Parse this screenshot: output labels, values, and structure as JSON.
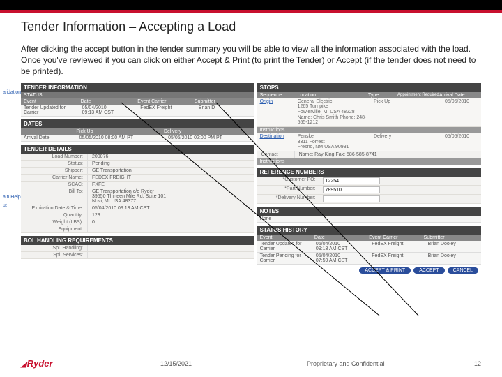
{
  "slide": {
    "title": "Tender Information – Accepting a Load",
    "body": "After clicking the accept button in the tender summary you will be able to view all the information associated with the load. Once you've reviewed it you can click on either Accept & Print (to print the Tender) or Accept (if the tender does not need to be printed)."
  },
  "left": {
    "tender_info": "TENDER INFORMATION",
    "status": "STATUS",
    "status_cols": {
      "event": "Event",
      "date": "Date",
      "carrier": "Event Carrier",
      "submitter": "Submitter"
    },
    "status_row": {
      "event": "Tender Updated for Carrier",
      "date1": "05/04/2010",
      "date2": "09:13 AM CST",
      "carrier": "FedEX Freight",
      "submitter": "Brian D"
    },
    "dates": "DATES",
    "dates_cols": {
      "blank": "",
      "pickup": "Pick Up",
      "delivery": "Delivery"
    },
    "dates_row": {
      "label": "Arrival Date",
      "pickup": "05/05/2010 08:00 AM PT",
      "delivery": "05/05/2010 02:00 PM PT"
    },
    "details": "TENDER DETAILS",
    "d": {
      "load_no_k": "Load Number:",
      "load_no_v": "200076",
      "status_k": "Status:",
      "status_v": "Pending",
      "shipper_k": "Shipper:",
      "shipper_v": "GE Transportation",
      "carrier_k": "Carrier Name:",
      "carrier_v": "FEDEX FREIGHT",
      "scac_k": "SCAC:",
      "scac_v": "FXFE",
      "billto_k": "Bill To:",
      "billto_v": "GE Transportation c/o Ryder\n39550 Thirteen Mile Rd. Suite 101\nNovi, MI USA 48377",
      "exp_k": "Expiration Date & Time:",
      "exp_v": "05/04/2010 09:13 AM CST",
      "qty_k": "Quantity:",
      "qty_v": "123",
      "wt_k": "Weight (LBS):",
      "wt_v": "0",
      "eq_k": "Equipment:",
      "eq_v": ""
    },
    "bol": "BOL HANDLING REQUIREMENTS",
    "bol_rows": {
      "spl_handling": "Spl. Handling:",
      "spl_services": "Spl. Services:"
    }
  },
  "right": {
    "stops": "STOPS",
    "stops_cols": {
      "seq": "Sequence",
      "loc": "Location",
      "type": "Type",
      "appt": "Appointment Required",
      "arr": "Arrival Date"
    },
    "stop1": {
      "seq": "Origin",
      "loc": "General Electric\n1265 Turnpike\nFowlerville, MI USA  48228\nName: Chris  Smith   Phone: 248-555-1212",
      "type": "Pick Up",
      "arr": "05/05/2010"
    },
    "stop2": {
      "seq": "Destination",
      "loc": "Penske\n3311 Forrest\nFresno, NM USA  90931",
      "type": "Delivery",
      "arr": "05/05/2010"
    },
    "contact": {
      "k": "Contact",
      "v": "Name: Ray King   Fax: 586-585-8741"
    },
    "instructions_k": "Instructions",
    "refnums": "REFERENCE NUMBERS",
    "ref": {
      "cust_po_k": "*Customer PO:",
      "cust_po_v": "12254",
      "part_k": "*Part Number:",
      "part_v": "789510",
      "del_k": "*Delivery Number:",
      "del_v": ""
    },
    "notes": "NOTES",
    "notes_v": "None",
    "history": "STATUS HISTORY",
    "hist_cols": {
      "event": "Event",
      "date": "Date",
      "carrier": "Event Carrier",
      "submitter": "Submitter"
    },
    "hist1": {
      "event": "Tender Updated for Carrier",
      "date": "05/04/2010\n09:13 AM CST",
      "carrier": "FedEX Freight",
      "submitter": "Brian Dooley"
    },
    "hist2": {
      "event": "Tender Pending for Carrier",
      "date": "05/04/2010\n07:59 AM CST",
      "carrier": "FedEX Freight",
      "submitter": "Brian Dooley"
    },
    "buttons": {
      "accept_print": "ACCEPT & PRINT",
      "accept": "ACCEPT",
      "cancel": "CANCEL"
    }
  },
  "sidemarks": {
    "validation": "alidation",
    "help": "ain Help",
    "out": "ut"
  },
  "footer": {
    "logo": "Ryder",
    "date": "12/15/2021",
    "prop": "Proprietary and Confidential",
    "page": "12"
  }
}
